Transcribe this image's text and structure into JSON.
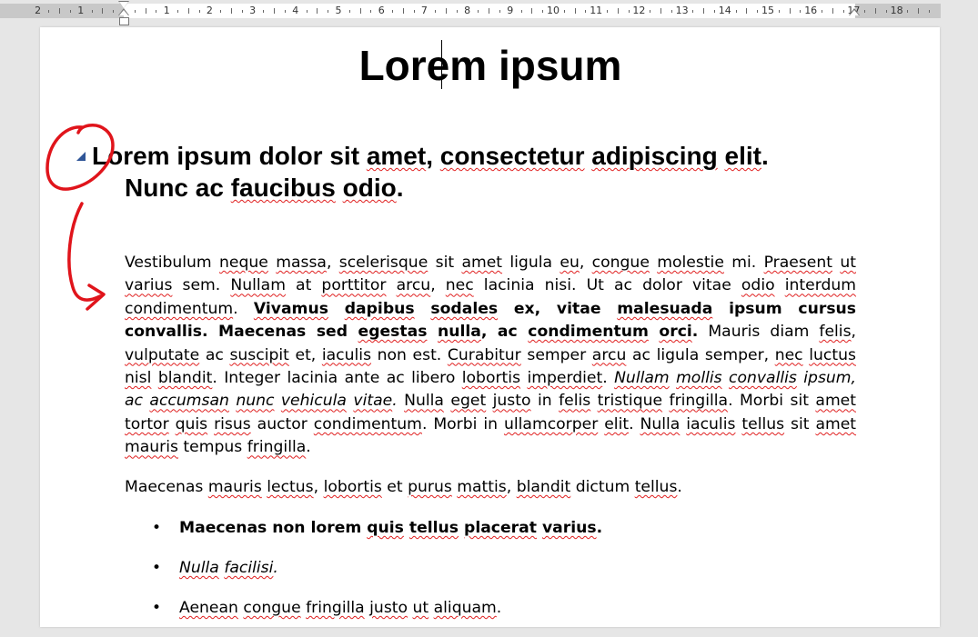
{
  "ruler": {
    "numbers_left": [
      "2",
      "1"
    ],
    "numbers": [
      "1",
      "2",
      "3",
      "4",
      "5",
      "6",
      "7",
      "8",
      "9",
      "10",
      "11",
      "12",
      "13",
      "14",
      "15",
      "16",
      "17",
      "18"
    ]
  },
  "document": {
    "title": "Lorem ipsum",
    "heading": {
      "line1": {
        "p1": "Lorem ipsum dolor sit ",
        "w1": "amet",
        "p2": ", ",
        "w2": "consectetur",
        "p3": " ",
        "w3": "adipiscing",
        "p4": " ",
        "w4": "elit",
        "p5": "."
      },
      "line2": {
        "p1": "Nunc ac ",
        "w1": "faucibus",
        "p2": " ",
        "w2": "odio",
        "p3": "."
      }
    },
    "paragraph1": [
      {
        "t": "Vestibulum ",
        "s": ""
      },
      {
        "t": "neque",
        "s": "sq"
      },
      {
        "t": " ",
        "s": ""
      },
      {
        "t": "massa",
        "s": "sq"
      },
      {
        "t": ", ",
        "s": ""
      },
      {
        "t": "scelerisque",
        "s": "sq"
      },
      {
        "t": " sit ",
        "s": ""
      },
      {
        "t": "amet",
        "s": "sq"
      },
      {
        "t": " ligula ",
        "s": ""
      },
      {
        "t": "eu",
        "s": "sq"
      },
      {
        "t": ", ",
        "s": ""
      },
      {
        "t": "congue",
        "s": "sq"
      },
      {
        "t": " ",
        "s": ""
      },
      {
        "t": "molestie",
        "s": "sq"
      },
      {
        "t": " mi. ",
        "s": ""
      },
      {
        "t": "Praesent",
        "s": "sq"
      },
      {
        "t": " ",
        "s": ""
      },
      {
        "t": "ut",
        "s": "sq"
      },
      {
        "t": " ",
        "s": ""
      },
      {
        "t": "varius",
        "s": "sq"
      },
      {
        "t": " sem. ",
        "s": ""
      },
      {
        "t": "Nullam",
        "s": "sq"
      },
      {
        "t": " at ",
        "s": ""
      },
      {
        "t": "porttitor",
        "s": "sq"
      },
      {
        "t": " ",
        "s": ""
      },
      {
        "t": "arcu",
        "s": "sq"
      },
      {
        "t": ", ",
        "s": ""
      },
      {
        "t": "nec",
        "s": "sq"
      },
      {
        "t": " lacinia nisi. Ut ac dolor vitae ",
        "s": ""
      },
      {
        "t": "odio",
        "s": "sq"
      },
      {
        "t": " ",
        "s": ""
      },
      {
        "t": "interdum",
        "s": "sq"
      },
      {
        "t": " ",
        "s": ""
      },
      {
        "t": "condimentum",
        "s": "sq"
      },
      {
        "t": ". ",
        "s": ""
      },
      {
        "t": "Vivamus",
        "s": "sq b"
      },
      {
        "t": " ",
        "s": "b"
      },
      {
        "t": "dapibus",
        "s": "sq b"
      },
      {
        "t": " ",
        "s": "b"
      },
      {
        "t": "sodales",
        "s": "sq b"
      },
      {
        "t": " ex, vitae ",
        "s": "b"
      },
      {
        "t": "malesuada",
        "s": "sq b"
      },
      {
        "t": " ipsum cursus convallis. Maecenas sed ",
        "s": "b"
      },
      {
        "t": "egestas",
        "s": "sq b"
      },
      {
        "t": " ",
        "s": "b"
      },
      {
        "t": "nulla",
        "s": "sq b"
      },
      {
        "t": ", ac ",
        "s": "b"
      },
      {
        "t": "condimentum",
        "s": "sq b"
      },
      {
        "t": " ",
        "s": "b"
      },
      {
        "t": "orci",
        "s": "sq b"
      },
      {
        "t": ".",
        "s": "b"
      },
      {
        "t": " Mauris diam ",
        "s": ""
      },
      {
        "t": "felis",
        "s": "sq"
      },
      {
        "t": ", ",
        "s": ""
      },
      {
        "t": "vulputate",
        "s": "sq"
      },
      {
        "t": " ac ",
        "s": ""
      },
      {
        "t": "suscipit",
        "s": "sq"
      },
      {
        "t": " et, ",
        "s": ""
      },
      {
        "t": "iaculis",
        "s": "sq"
      },
      {
        "t": " non est. ",
        "s": ""
      },
      {
        "t": "Curabitur",
        "s": "sq"
      },
      {
        "t": " semper ",
        "s": ""
      },
      {
        "t": "arcu",
        "s": "sq"
      },
      {
        "t": " ac ligula semper, ",
        "s": ""
      },
      {
        "t": "nec",
        "s": "sq"
      },
      {
        "t": " ",
        "s": ""
      },
      {
        "t": "luctus",
        "s": "sq"
      },
      {
        "t": " ",
        "s": ""
      },
      {
        "t": "nisl",
        "s": "sq"
      },
      {
        "t": " ",
        "s": ""
      },
      {
        "t": "blandit",
        "s": "sq"
      },
      {
        "t": ". Integer lacinia ante ac libero ",
        "s": ""
      },
      {
        "t": "lobortis",
        "s": "sq"
      },
      {
        "t": " ",
        "s": ""
      },
      {
        "t": "imperdiet",
        "s": "sq"
      },
      {
        "t": ". ",
        "s": ""
      },
      {
        "t": "Nullam",
        "s": "sq i"
      },
      {
        "t": " ",
        "s": "i"
      },
      {
        "t": "mollis",
        "s": "sq i"
      },
      {
        "t": " ",
        "s": "i"
      },
      {
        "t": "convallis",
        "s": "sq i"
      },
      {
        "t": " ipsum, ac ",
        "s": "i"
      },
      {
        "t": "accumsan",
        "s": "sq i"
      },
      {
        "t": " ",
        "s": "i"
      },
      {
        "t": "nunc",
        "s": "sq i"
      },
      {
        "t": " ",
        "s": "i"
      },
      {
        "t": "vehicula",
        "s": "sq i"
      },
      {
        "t": " ",
        "s": "i"
      },
      {
        "t": "vitae",
        "s": "sq i"
      },
      {
        "t": ".",
        "s": "i"
      },
      {
        "t": " ",
        "s": ""
      },
      {
        "t": "Nulla",
        "s": "sq"
      },
      {
        "t": " ",
        "s": ""
      },
      {
        "t": "eget",
        "s": "sq"
      },
      {
        "t": " ",
        "s": ""
      },
      {
        "t": "justo",
        "s": "sq"
      },
      {
        "t": " in ",
        "s": ""
      },
      {
        "t": "felis",
        "s": "sq"
      },
      {
        "t": " ",
        "s": ""
      },
      {
        "t": "tristique",
        "s": "sq"
      },
      {
        "t": " ",
        "s": ""
      },
      {
        "t": "fringilla",
        "s": "sq"
      },
      {
        "t": ". Morbi sit ",
        "s": ""
      },
      {
        "t": "amet",
        "s": "sq"
      },
      {
        "t": " ",
        "s": ""
      },
      {
        "t": "tortor",
        "s": "sq"
      },
      {
        "t": " ",
        "s": ""
      },
      {
        "t": "quis",
        "s": "sq"
      },
      {
        "t": " ",
        "s": ""
      },
      {
        "t": "risus",
        "s": "sq"
      },
      {
        "t": " auctor ",
        "s": ""
      },
      {
        "t": "condimentum",
        "s": "sq"
      },
      {
        "t": ". Morbi in ",
        "s": ""
      },
      {
        "t": "ullamcorper",
        "s": "sq"
      },
      {
        "t": " ",
        "s": ""
      },
      {
        "t": "elit",
        "s": "sq"
      },
      {
        "t": ". ",
        "s": ""
      },
      {
        "t": "Nulla",
        "s": "sq"
      },
      {
        "t": " ",
        "s": ""
      },
      {
        "t": "iaculis",
        "s": "sq"
      },
      {
        "t": " ",
        "s": ""
      },
      {
        "t": "tellus",
        "s": "sq"
      },
      {
        "t": " sit ",
        "s": ""
      },
      {
        "t": "amet",
        "s": "sq"
      },
      {
        "t": " ",
        "s": ""
      },
      {
        "t": "mauris",
        "s": "sq"
      },
      {
        "t": " tempus ",
        "s": ""
      },
      {
        "t": "fringilla",
        "s": "sq"
      },
      {
        "t": ".",
        "s": ""
      }
    ],
    "paragraph2": [
      {
        "t": "Maecenas ",
        "s": ""
      },
      {
        "t": "mauris",
        "s": "sq"
      },
      {
        "t": " ",
        "s": ""
      },
      {
        "t": "lectus",
        "s": "sq"
      },
      {
        "t": ", ",
        "s": ""
      },
      {
        "t": "lobortis",
        "s": "sq"
      },
      {
        "t": " et ",
        "s": ""
      },
      {
        "t": "purus",
        "s": "sq"
      },
      {
        "t": " ",
        "s": ""
      },
      {
        "t": "mattis",
        "s": "sq"
      },
      {
        "t": ", ",
        "s": ""
      },
      {
        "t": "blandit",
        "s": "sq"
      },
      {
        "t": " dictum ",
        "s": ""
      },
      {
        "t": "tellus",
        "s": "sq"
      },
      {
        "t": ".",
        "s": ""
      }
    ],
    "bullets": [
      [
        {
          "t": "Maecenas non lorem ",
          "s": "b"
        },
        {
          "t": "quis",
          "s": "sq b"
        },
        {
          "t": " ",
          "s": "b"
        },
        {
          "t": "tellus",
          "s": "sq b"
        },
        {
          "t": " ",
          "s": "b"
        },
        {
          "t": "placerat",
          "s": "sq b"
        },
        {
          "t": " ",
          "s": "b"
        },
        {
          "t": "varius",
          "s": "sq b"
        },
        {
          "t": ".",
          "s": "b"
        }
      ],
      [
        {
          "t": "Nulla",
          "s": "sq i"
        },
        {
          "t": " ",
          "s": "i"
        },
        {
          "t": "facilisi",
          "s": "sq i"
        },
        {
          "t": ".",
          "s": "i"
        }
      ],
      [
        {
          "t": "Aenean",
          "s": "sq"
        },
        {
          "t": " ",
          "s": ""
        },
        {
          "t": "congue",
          "s": "sq"
        },
        {
          "t": " ",
          "s": ""
        },
        {
          "t": "fringilla",
          "s": "sq"
        },
        {
          "t": " ",
          "s": ""
        },
        {
          "t": "justo",
          "s": "sq"
        },
        {
          "t": " ",
          "s": ""
        },
        {
          "t": "ut",
          "s": "sq"
        },
        {
          "t": " ",
          "s": ""
        },
        {
          "t": "aliquam",
          "s": "sq"
        },
        {
          "t": ".",
          "s": ""
        }
      ]
    ],
    "bullet_glyph": "•"
  },
  "colors": {
    "spell_squiggle": "#e02020",
    "annotation_red": "#e0141b",
    "collapse_triangle": "#2f5597"
  }
}
